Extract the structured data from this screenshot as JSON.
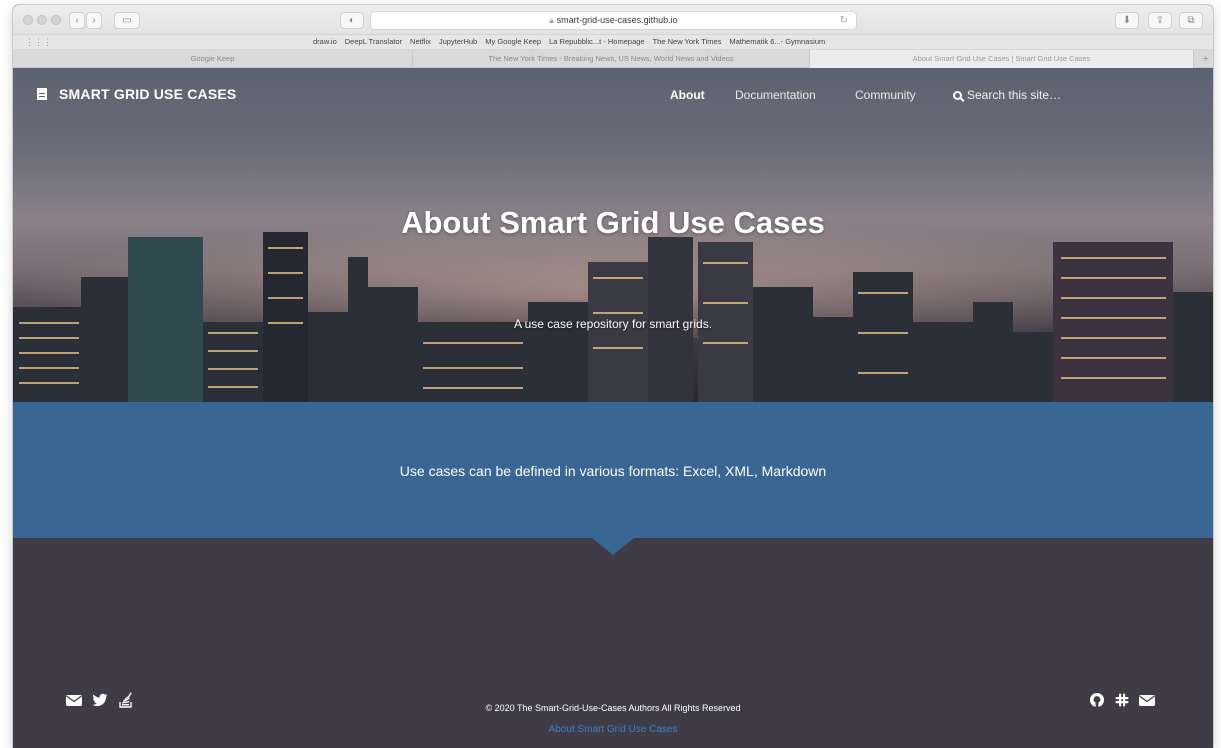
{
  "browser": {
    "url": "smart-grid-use-cases.github.io",
    "bookmarks": [
      "draw.io",
      "DeepL Translator",
      "Netflix",
      "JupyterHub",
      "My Google Keep",
      "La Repubblic...t - Homepage",
      "The New York Times",
      "Mathematik 6...- Gymnasium"
    ],
    "tabs": [
      {
        "label": "Google Keep",
        "active": false
      },
      {
        "label": "The New York Times - Breaking News, US News, World News and Videos",
        "active": false
      },
      {
        "label": "About Smart Grid Use Cases | Smart Grid Use Cases",
        "active": true
      }
    ]
  },
  "site": {
    "brand": "SMART GRID USE CASES",
    "nav": [
      {
        "label": "About",
        "active": true
      },
      {
        "label": "Documentation",
        "active": false
      },
      {
        "label": "Community",
        "active": false
      }
    ],
    "search_placeholder": "Search this site…"
  },
  "hero": {
    "title": "About Smart Grid Use Cases",
    "subtitle": "A use case repository for smart grids."
  },
  "band": {
    "text": "Use cases can be defined in various formats: Excel, XML, Markdown"
  },
  "footer": {
    "left_icons": [
      "envelope-icon",
      "twitter-icon",
      "stack-overflow-icon"
    ],
    "right_icons": [
      "github-icon",
      "slack-icon",
      "envelope-icon"
    ],
    "copyright": "© 2020 The Smart-Grid-Use-Cases Authors All Rights Reserved",
    "link": "About Smart Grid Use Cases"
  },
  "colors": {
    "band": "#3a6694",
    "footer_bg": "#3f3c48",
    "footer_link": "#3b7ec0"
  }
}
